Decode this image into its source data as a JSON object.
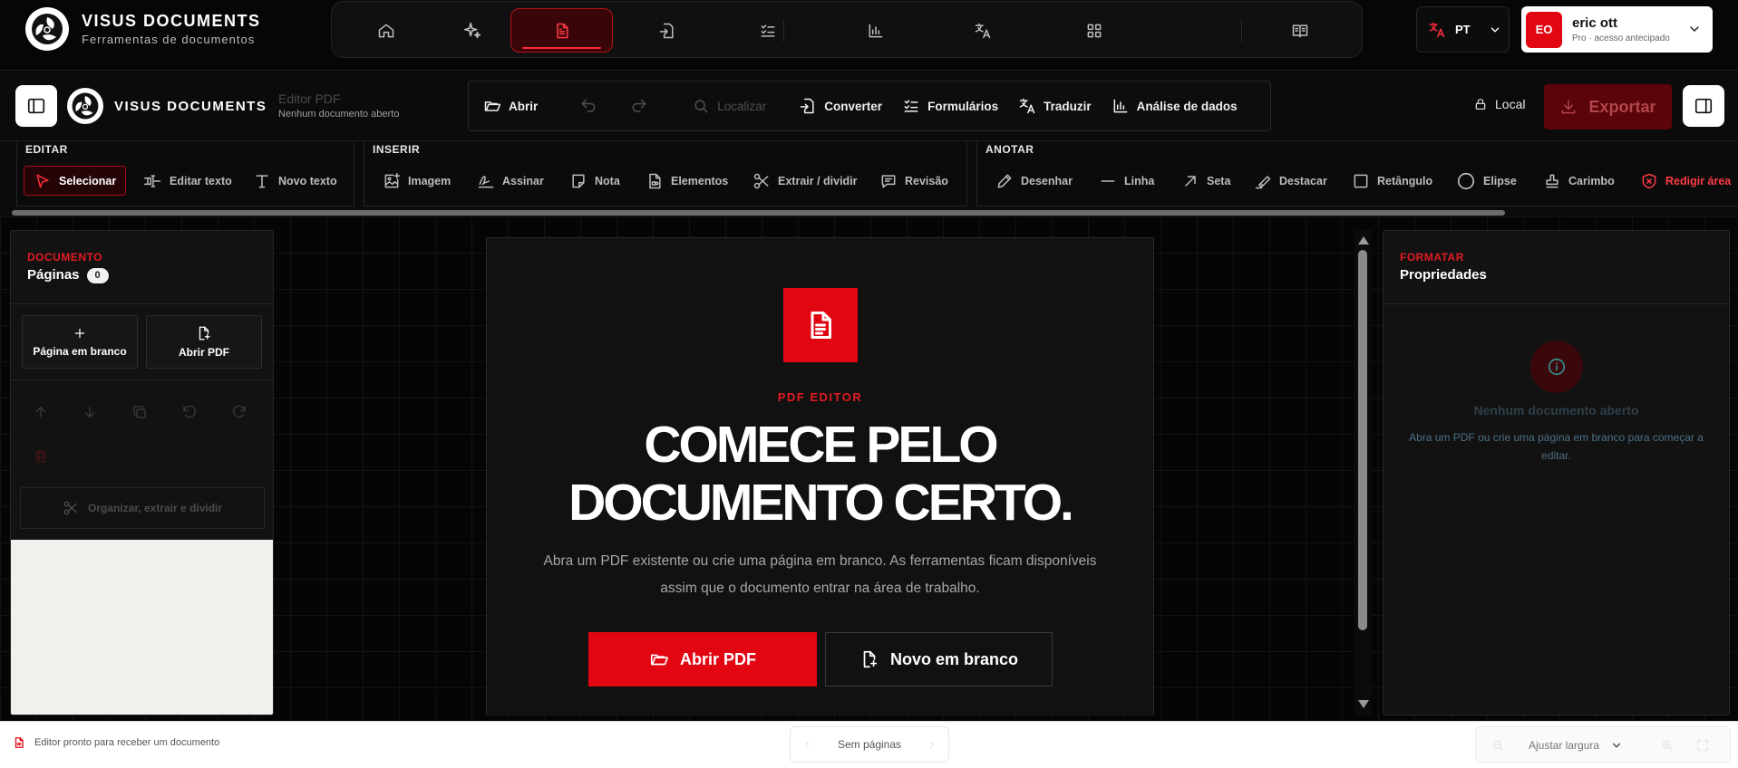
{
  "app": {
    "name": "VISUS DOCUMENTS",
    "subtitle": "Ferramentas de documentos"
  },
  "topnav": {
    "items": [
      {
        "icon": "home-icon"
      },
      {
        "icon": "sparkle-icon"
      },
      {
        "icon": "pdf-document-icon",
        "active": true
      },
      {
        "icon": "convert-icon"
      },
      {
        "icon": "checklist-icon"
      },
      {
        "icon": "bar-chart-icon"
      },
      {
        "icon": "translate-icon"
      },
      {
        "icon": "grid-icon"
      },
      {
        "icon": "book-icon"
      }
    ],
    "language": "PT",
    "user": {
      "initials": "EO",
      "name": "eric ott",
      "plan": "Pro · acesso antecipado"
    }
  },
  "editor_header": {
    "brand": "VISUS DOCUMENTS",
    "doc_title": "Editor PDF",
    "doc_status": "Nenhum documento aberto",
    "toolbar": {
      "open": "Abrir",
      "find": "Localizar",
      "convert": "Converter",
      "forms": "Formulários",
      "translate": "Traduzir",
      "analysis": "Análise de dados"
    },
    "storage": "Local",
    "export": "Exportar"
  },
  "ribbon": {
    "edit": {
      "title": "EDITAR",
      "tools": {
        "select": "Selecionar",
        "edit_text": "Editar texto",
        "new_text": "Novo texto"
      }
    },
    "insert": {
      "title": "INSERIR",
      "tools": {
        "image": "Imagem",
        "sign": "Assinar",
        "note": "Nota",
        "elements": "Elementos",
        "extract": "Extrair / dividir",
        "review": "Revisão"
      }
    },
    "annotate": {
      "title": "ANOTAR",
      "tools": {
        "draw": "Desenhar",
        "line": "Linha",
        "arrow": "Seta",
        "highlight": "Destacar",
        "rectangle": "Retângulo",
        "ellipse": "Elipse",
        "stamp": "Carimbo",
        "redact": "Redigir área"
      }
    }
  },
  "left_panel": {
    "tag": "DOCUMENTO",
    "title": "Páginas",
    "page_count": "0",
    "blank_page": "Página em branco",
    "open_pdf": "Abrir PDF",
    "organize": "Organizar, extrair e dividir"
  },
  "center": {
    "eyebrow": "PDF EDITOR",
    "headline_1": "COMECE PELO",
    "headline_2": "DOCUMENTO CERTO.",
    "description": "Abra um PDF existente ou crie uma página em branco. As ferramentas ficam disponíveis assim que o documento entrar na área de trabalho.",
    "open_button": "Abrir PDF",
    "new_button": "Novo em branco"
  },
  "right_panel": {
    "tag": "FORMATAR",
    "title": "Propriedades",
    "empty_title": "Nenhum documento aberto",
    "empty_text": "Abra um PDF ou crie uma página em branco para começar a editar."
  },
  "status": {
    "message": "Editor pronto para receber um documento",
    "pages": "Sem páginas",
    "zoom": "Ajustar largura"
  },
  "colors": {
    "accent": "#e20613",
    "background": "#0a0a0a",
    "panel": "#121212"
  }
}
